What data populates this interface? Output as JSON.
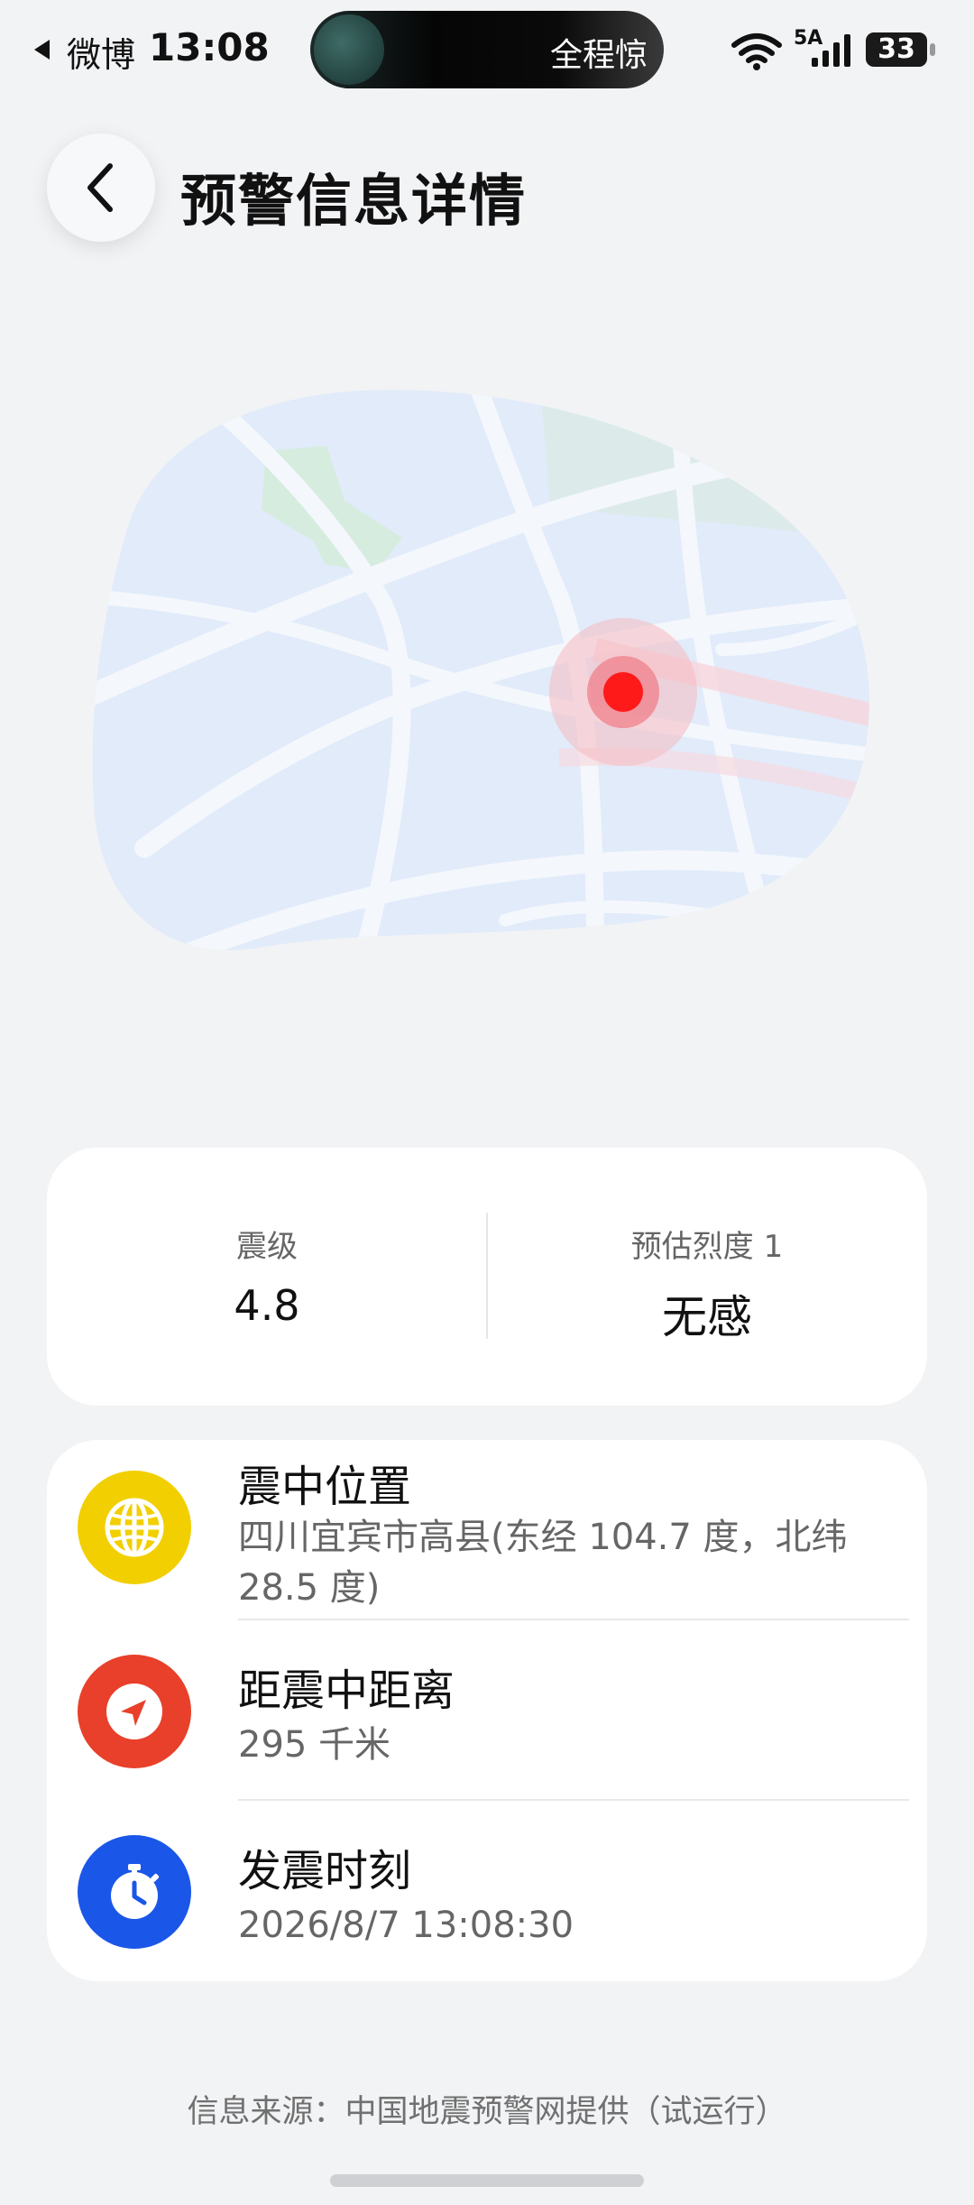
{
  "status_bar": {
    "back_app": "微博",
    "time": "13:08",
    "island_text": "全程惊",
    "network_5a": "5A",
    "battery": "33"
  },
  "header": {
    "title": "预警信息详情"
  },
  "magnitude": {
    "label": "震级",
    "value": "4.8",
    "intensity_label": "预估烈度 1",
    "intensity_value": "无感"
  },
  "info": {
    "epicenter": {
      "title": "震中位置",
      "value": "四川宜宾市高县(东经 104.7 度，北纬 28.5 度)",
      "icon": "globe-icon",
      "color": "#f2cf00"
    },
    "distance": {
      "title": "距震中距离",
      "value": "295 千米",
      "icon": "navigation-arrow-icon",
      "color": "#e8402a"
    },
    "time": {
      "title": "发震时刻",
      "value": "2026/8/7 13:08:30",
      "icon": "stopwatch-icon",
      "color": "#1a56e8"
    }
  },
  "footer": {
    "source": "信息来源：中国地震预警网提供（试运行）"
  },
  "colors": {
    "background": "#f2f3f5",
    "epicenter_dot": "#ff1a1a",
    "map_water": "#e1ebfa"
  }
}
